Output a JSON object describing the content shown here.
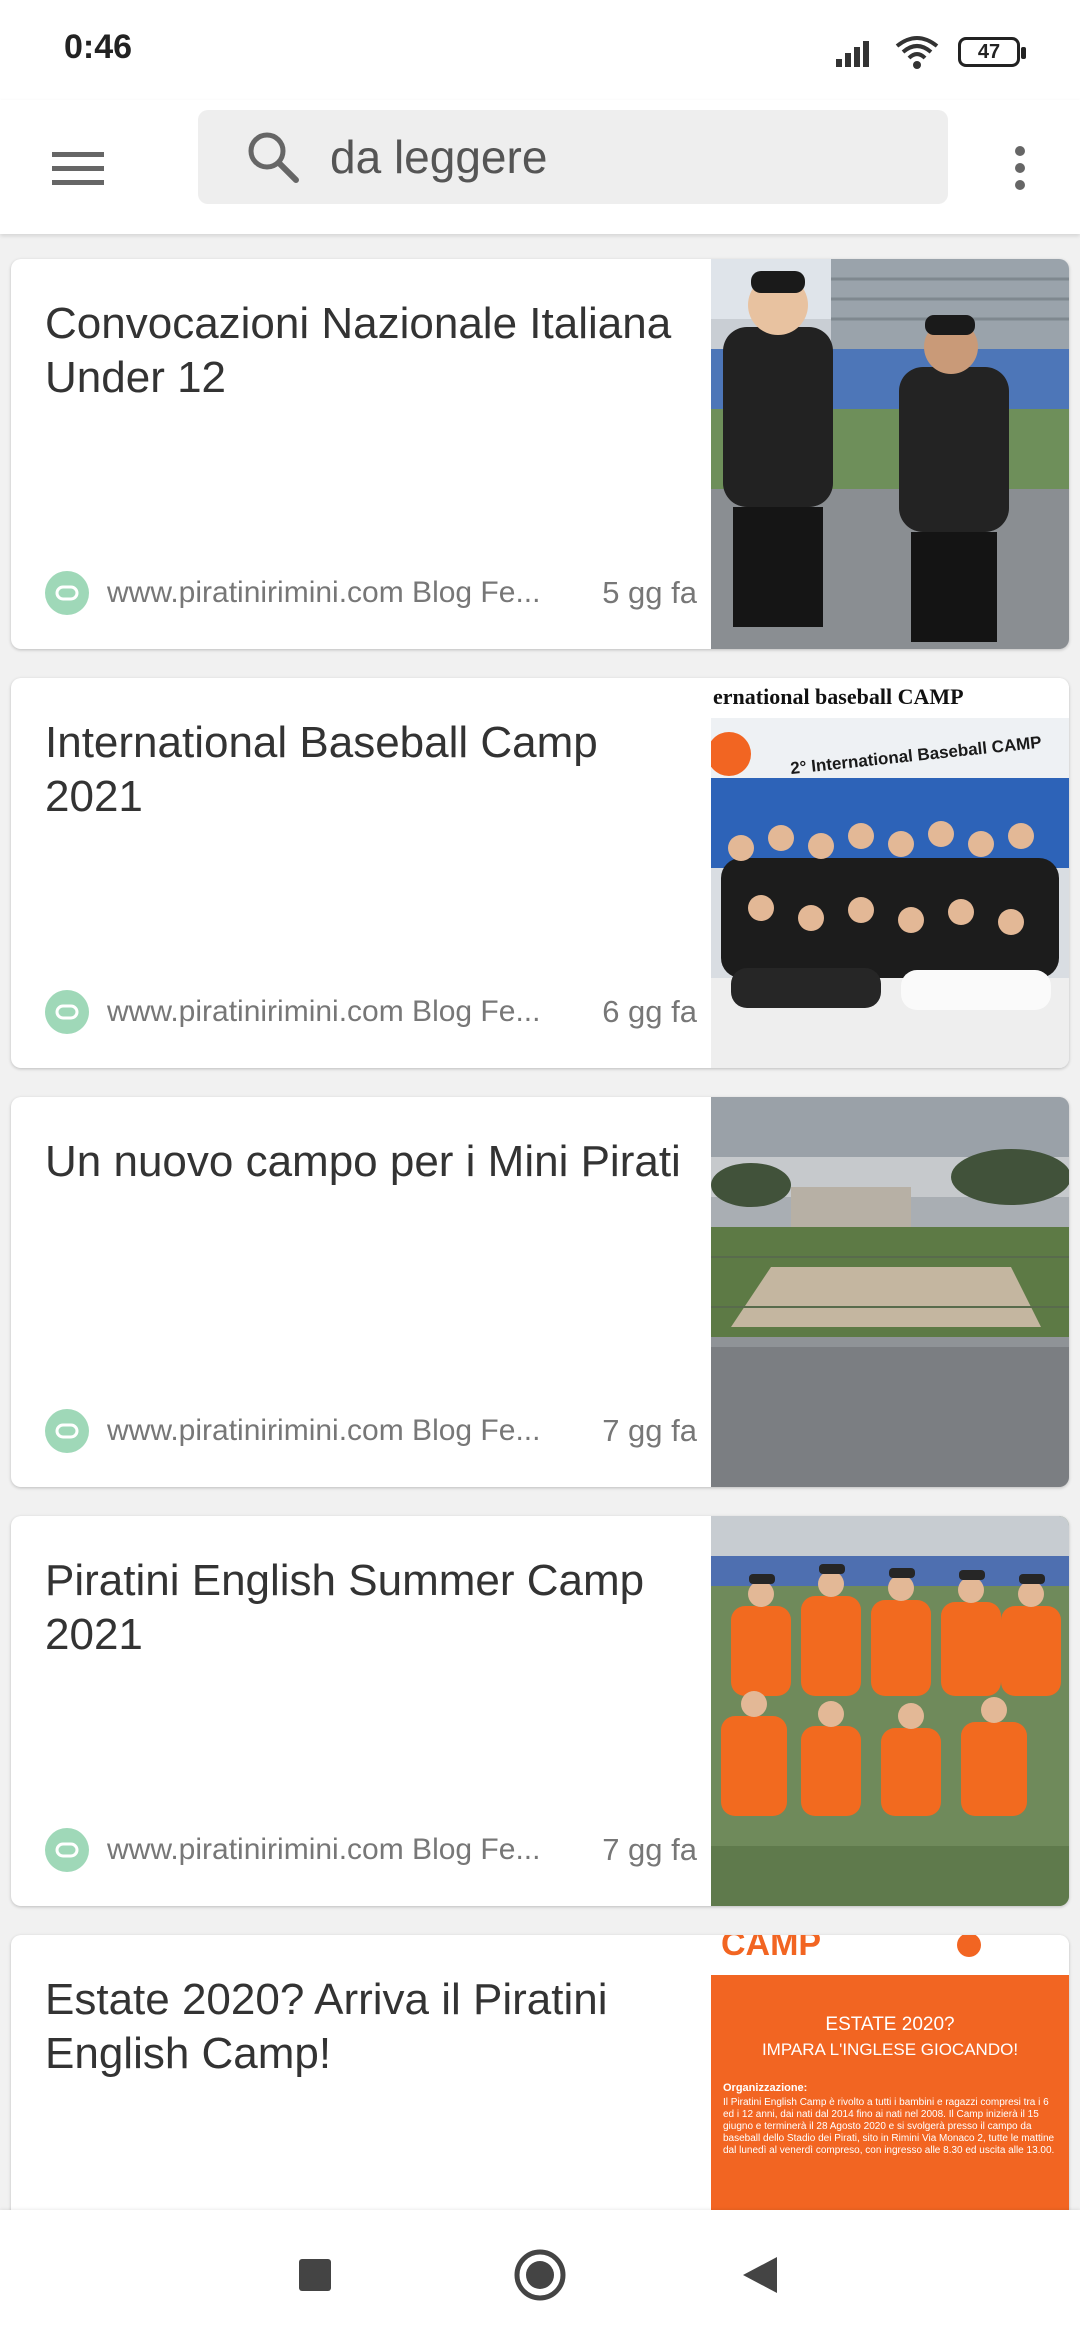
{
  "status": {
    "time": "0:46",
    "battery": "47"
  },
  "toolbar": {
    "search_text": "da leggere"
  },
  "articles": [
    {
      "title": "Convocazioni Nazionale Italiana Under 12",
      "source": "www.piratinirimini.com Blog Fe...",
      "age": "5 gg fa"
    },
    {
      "title": "International Baseball Camp 2021",
      "source": "www.piratinirimini.com Blog Fe...",
      "age": "6 gg fa",
      "thumb_text": {
        "top": "ernational baseball CAMP",
        "banner": "2° International Baseball CAMP"
      }
    },
    {
      "title": "Un nuovo campo per i Mini Pirati",
      "source": "www.piratinirimini.com Blog Fe...",
      "age": "7 gg fa"
    },
    {
      "title": "Piratini English Summer Camp 2021",
      "source": "www.piratinirimini.com Blog Fe...",
      "age": "7 gg fa"
    },
    {
      "title": "Estate 2020? Arriva il Piratini English Camp!",
      "source": "",
      "age": "",
      "thumb_text": {
        "logo": "CAMP",
        "line1": "ESTATE 2020?",
        "line2": "IMPARA L'INGLESE GIOCANDO!",
        "org_label": "Organizzazione:",
        "body": "Il Piratini English Camp è rivolto a tutti i bambini e ragazzi compresi tra i 6 ed i 12 anni, dai nati dal 2014 fino ai nati nel 2008. Il Camp inizierà il 15 giugno e terminerà il 28 Agosto 2020 e si svolgerà presso il campo da baseball dello Stadio dei Pirati, sito in Rimini Via Monaco 2, tutte le mattine dal lunedì al venerdì compreso, con ingresso alle 8.30 ed uscita alle 13.00."
      }
    }
  ],
  "colors": {
    "accent_orange": "#f26522",
    "tag_green": "#9fd8b8",
    "field_blue": "#2d63b8"
  },
  "icons": {
    "menu": "hamburger-icon",
    "search": "search-icon",
    "more": "more-vert-icon",
    "tag": "tag-icon",
    "nav_recents": "square-icon",
    "nav_home": "circle-icon",
    "nav_back": "triangle-back-icon"
  }
}
